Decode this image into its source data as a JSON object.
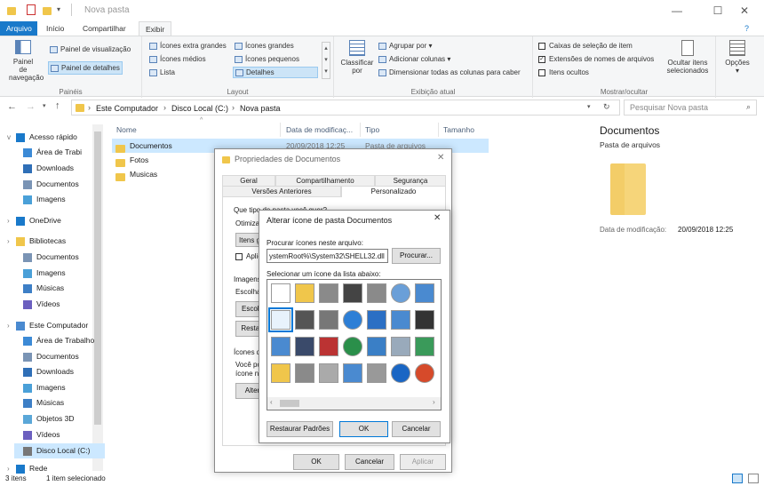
{
  "title": "Nova pasta",
  "window_controls": {
    "minimize": "—",
    "maximize": "☐",
    "close": "✕"
  },
  "menu_tabs": [
    "Arquivo",
    "Início",
    "Compartilhar",
    "Exibir"
  ],
  "ribbon": {
    "panes": {
      "nav_pane": "Painel de\nnavegação",
      "preview": "Painel de visualização",
      "details": "Painel de detalhes",
      "label": "Painéis"
    },
    "layout": {
      "items": [
        "Ícones extra grandes",
        "Ícones grandes",
        "Ícones médios",
        "Ícones pequenos",
        "Lista",
        "Detalhes"
      ],
      "label": "Layout"
    },
    "current_view": {
      "sort": "Classificar\npor",
      "group": "Agrupar por",
      "add_cols": "Adicionar colunas",
      "fit_cols": "Dimensionar todas as colunas para caber",
      "label": "Exibição atual"
    },
    "show_hide": {
      "checkboxes": "Caixas de seleção de item",
      "extensions": "Extensões de nomes de arquivos",
      "hidden": "Itens ocultos",
      "hide_selected": "Ocultar itens\nselecionados",
      "label": "Mostrar/ocultar"
    },
    "options": "Opções"
  },
  "address": {
    "crumbs": [
      "Este Computador",
      "Disco Local (C:)",
      "Nova pasta"
    ],
    "search_placeholder": "Pesquisar Nova pasta"
  },
  "nav": [
    {
      "label": "Acesso rápido",
      "x": 18,
      "icon": "star"
    },
    {
      "label": "Área de Trabi",
      "x": 26,
      "icon": "desktop"
    },
    {
      "label": "Downloads",
      "x": 26,
      "icon": "download"
    },
    {
      "label": "Documentos",
      "x": 26,
      "icon": "doc"
    },
    {
      "label": "Imagens",
      "x": 26,
      "icon": "img"
    },
    {
      "label": "OneDrive",
      "x": 18,
      "icon": "cloud"
    },
    {
      "label": "Bibliotecas",
      "x": 18,
      "icon": "folder"
    },
    {
      "label": "Documentos",
      "x": 26,
      "icon": "doc"
    },
    {
      "label": "Imagens",
      "x": 26,
      "icon": "img"
    },
    {
      "label": "Músicas",
      "x": 26,
      "icon": "music"
    },
    {
      "label": "Vídeos",
      "x": 26,
      "icon": "video"
    },
    {
      "label": "Este Computador",
      "x": 18,
      "icon": "pc"
    },
    {
      "label": "Área de Trabalho",
      "x": 26,
      "icon": "desktop"
    },
    {
      "label": "Documentos",
      "x": 26,
      "icon": "doc"
    },
    {
      "label": "Downloads",
      "x": 26,
      "icon": "download"
    },
    {
      "label": "Imagens",
      "x": 26,
      "icon": "img"
    },
    {
      "label": "Músicas",
      "x": 26,
      "icon": "music"
    },
    {
      "label": "Objetos 3D",
      "x": 26,
      "icon": "cube"
    },
    {
      "label": "Vídeos",
      "x": 26,
      "icon": "video"
    },
    {
      "label": "Disco Local (C:)",
      "x": 26,
      "icon": "drive"
    },
    {
      "label": "Rede",
      "x": 18,
      "icon": "net"
    }
  ],
  "columns": [
    "Nome",
    "Data de modificaç...",
    "Tipo",
    "Tamanho"
  ],
  "files": [
    {
      "name": "Documentos",
      "date": "20/09/2018 12:25",
      "type": "Pasta de arquivos"
    },
    {
      "name": "Fotos",
      "date": "",
      "type": ""
    },
    {
      "name": "Musicas",
      "date": "",
      "type": ""
    }
  ],
  "details": {
    "name": "Documentos",
    "type": "Pasta de arquivos",
    "date_label": "Data de modificação:",
    "date_value": "20/09/2018 12:25"
  },
  "status": {
    "count": "3 itens",
    "selected": "1 item selecionado"
  },
  "props_dialog": {
    "title": "Propriedades de Documentos",
    "tabs_row1": [
      "Geral",
      "Compartilhamento",
      "Segurança"
    ],
    "tabs_row2": [
      "Versões Anteriores",
      "Personalizado"
    ],
    "q1": "Que tipo de pasta você quer?",
    "opt": "Otimizar",
    "sel": "Itens g",
    "apply": "Aplic",
    "img": "Imagens",
    "choose": "Escolha",
    "choose_btn": "Escolh",
    "restore_btn": "Restau",
    "icons": "Ícones de",
    "icons_text1": "Você po",
    "icons_text2": "ícone n",
    "alter_btn": "Alter",
    "ok": "OK",
    "cancel": "Cancelar",
    "apply_btn": "Aplicar"
  },
  "icon_dialog": {
    "title": "Alterar ícone de pasta Documentos",
    "search_label": "Procurar ícones neste arquivo:",
    "path": "ystemRoot%\\System32\\SHELL32.dll",
    "browse": "Procurar...",
    "list_label": "Selecionar um ícone da lista abaixo:",
    "restore": "Restaurar Padrões",
    "ok": "OK",
    "cancel": "Cancelar",
    "icons": [
      [
        "blank-doc",
        "folder",
        "drive",
        "chip",
        "drive",
        "globe-cd",
        "window"
      ],
      [
        "doc-selected",
        "monitor",
        "drive-net",
        "globe",
        "cube",
        "window",
        "app"
      ],
      [
        "window",
        "floppy",
        "drive-x",
        "globe-music",
        "net",
        "search",
        "recycle"
      ],
      [
        "folder",
        "drive",
        "cd",
        "laptop",
        "grid",
        "help",
        "power"
      ]
    ]
  },
  "colors": {
    "accent": "#1979ca",
    "folder": "#f0c64b",
    "select": "#cce8ff"
  }
}
